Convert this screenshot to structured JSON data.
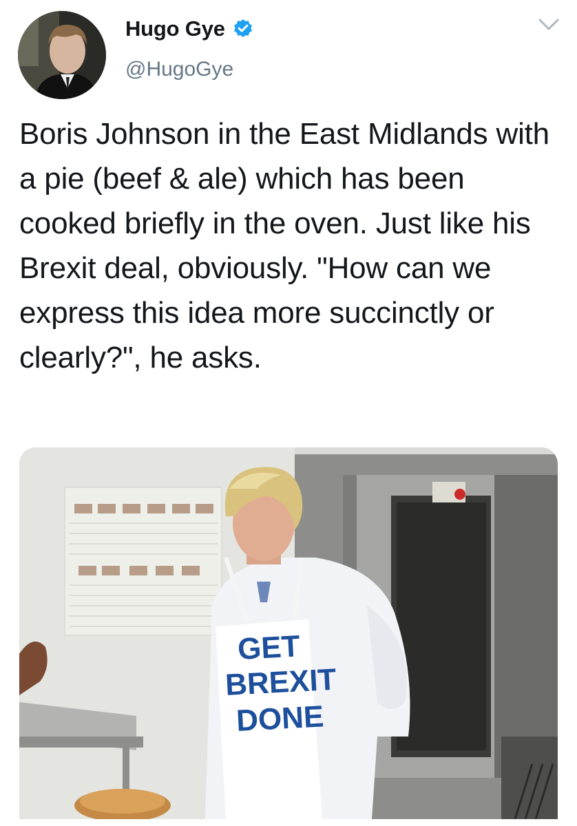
{
  "tweet": {
    "author": {
      "name": "Hugo Gye",
      "handle": "@HugoGye",
      "verified": true,
      "avatar_icon": "profile-photo"
    },
    "menu_icon": "chevron-down-icon",
    "text": "Boris Johnson in the East Midlands with a pie (beef & ale) which has been cooked briefly in the oven. Just like his Brexit deal, obviously. \"How can we express this idea more succinctly or clearly?\", he asks.",
    "media": {
      "apron_lines": [
        "GET",
        "BREXIT",
        "DONE"
      ]
    }
  },
  "colors": {
    "text": "#14171a",
    "secondary": "#657786",
    "verified_blue": "#1da1f2",
    "apron_blue": "#1d4f9c"
  }
}
